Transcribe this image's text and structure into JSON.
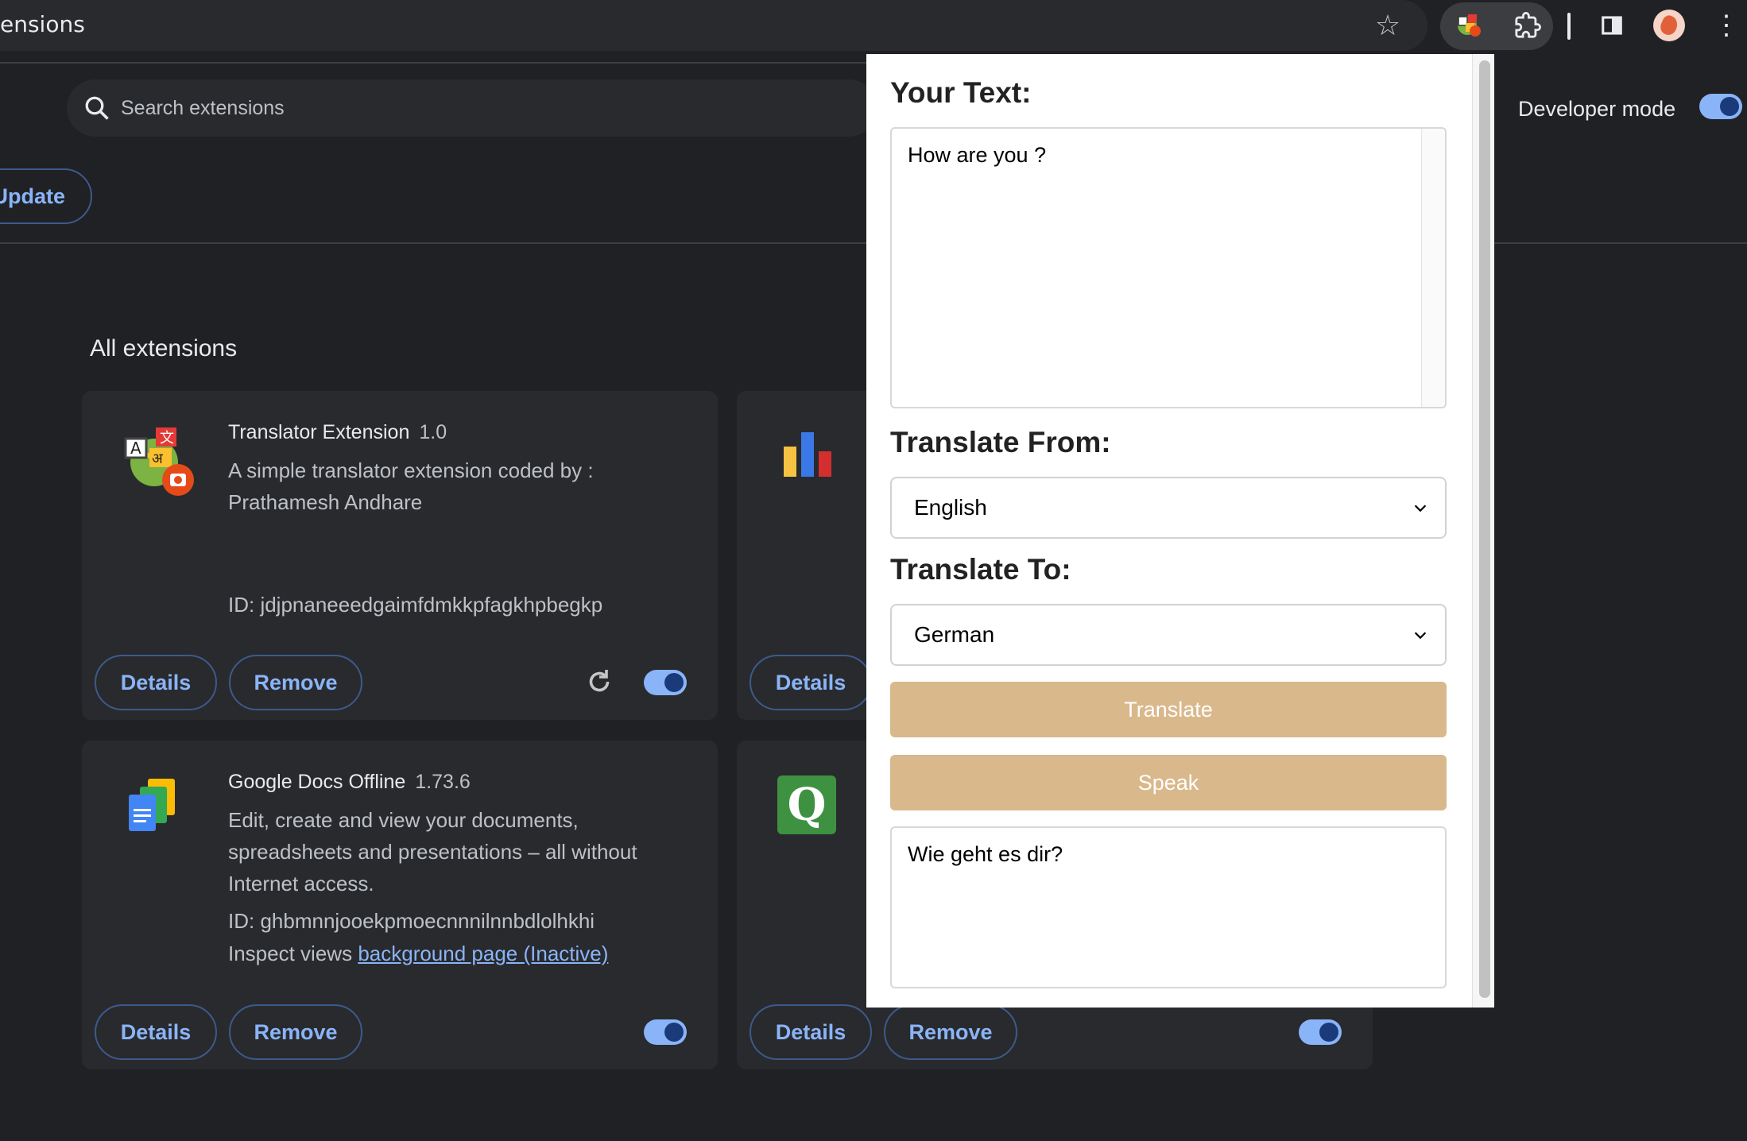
{
  "browser": {
    "omnibox_text": "ensions"
  },
  "search": {
    "placeholder": "Search extensions"
  },
  "developer_mode": {
    "label": "Developer mode",
    "enabled": true
  },
  "toolbar": {
    "update_label": "Update"
  },
  "section_title": "All extensions",
  "extensions": [
    {
      "name": "Translator Extension",
      "version": "1.0",
      "description": "A simple translator extension coded by : Prathamesh Andhare",
      "id": "ID: jdjpnaneeedgaimfdmkkpfagkhpbegkp",
      "details_label": "Details",
      "remove_label": "Remove",
      "enabled": true
    },
    {
      "details_label": "Details",
      "enabled": true
    },
    {
      "name": "Google Docs Offline",
      "version": "1.73.6",
      "description": "Edit, create and view your documents, spreadsheets and presentations – all without Internet access.",
      "id": "ID: ghbmnnjooekpmoecnnnilnnbdlolhkhi",
      "inspect_prefix": "Inspect views",
      "inspect_link": "background page (Inactive)",
      "details_label": "Details",
      "remove_label": "Remove",
      "enabled": true
    },
    {
      "details_label": "Details",
      "remove_label": "Remove",
      "enabled": true
    }
  ],
  "popup": {
    "your_text_label": "Your Text:",
    "input_text": "How are you ?",
    "from_label": "Translate From:",
    "from_value": "English",
    "to_label": "Translate To:",
    "to_value": "German",
    "translate_label": "Translate",
    "speak_label": "Speak",
    "output_text": "Wie geht es dir?",
    "button_color": "#d9b88b"
  }
}
